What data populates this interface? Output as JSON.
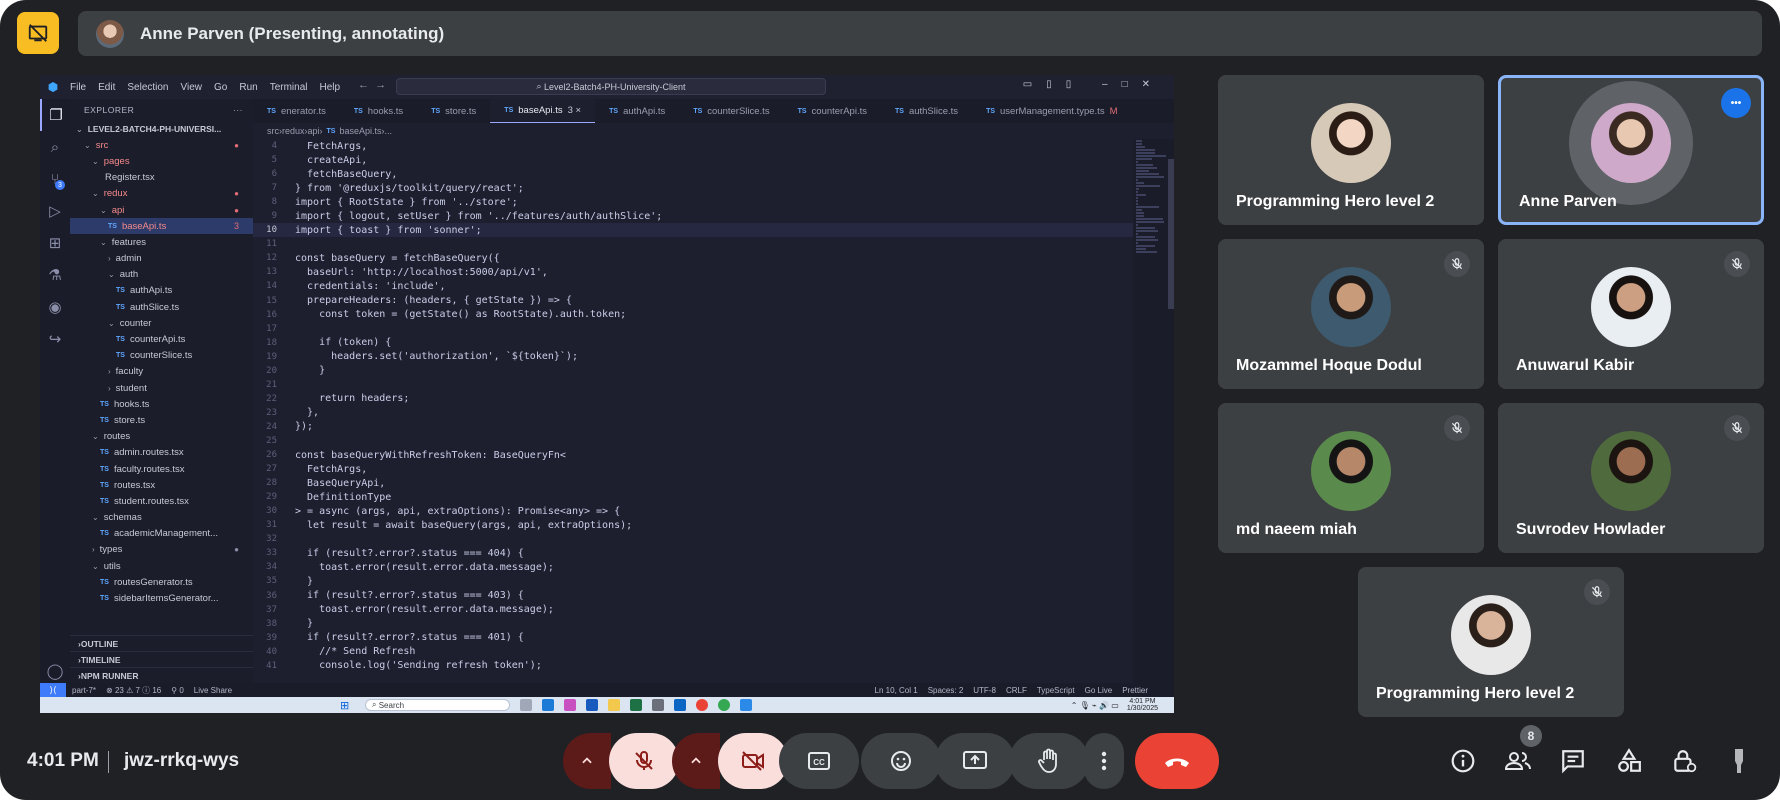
{
  "presenting": {
    "label": "Anne Parven (Presenting, annotating)"
  },
  "vscode": {
    "menu": [
      "File",
      "Edit",
      "Selection",
      "View",
      "Go",
      "Run",
      "Terminal",
      "Help"
    ],
    "search": "Level2-Batch4-PH-University-Client",
    "explorer_title": "EXPLORER",
    "project": "LEVEL2-BATCH4-PH-UNIVERSI...",
    "tree": [
      {
        "label": "src",
        "kind": "folder",
        "indent": 1,
        "status": "dot",
        "red": true
      },
      {
        "label": "pages",
        "kind": "folder",
        "indent": 2,
        "status": "",
        "red": true
      },
      {
        "label": "Register.tsx",
        "kind": "plain",
        "indent": 3,
        "status": ""
      },
      {
        "label": "redux",
        "kind": "folder",
        "indent": 2,
        "status": "dot",
        "red": true
      },
      {
        "label": "api",
        "kind": "folder",
        "indent": 3,
        "status": "dot",
        "red": true
      },
      {
        "label": "baseApi.ts",
        "kind": "ts",
        "indent": 4,
        "status": "3",
        "sel": true,
        "red": true
      },
      {
        "label": "features",
        "kind": "folder",
        "indent": 3,
        "status": ""
      },
      {
        "label": "admin",
        "kind": "folder-closed",
        "indent": 4,
        "status": ""
      },
      {
        "label": "auth",
        "kind": "folder",
        "indent": 4,
        "status": ""
      },
      {
        "label": "authApi.ts",
        "kind": "ts",
        "indent": 5,
        "status": ""
      },
      {
        "label": "authSlice.ts",
        "kind": "ts",
        "indent": 5,
        "status": ""
      },
      {
        "label": "counter",
        "kind": "folder",
        "indent": 4,
        "status": ""
      },
      {
        "label": "counterApi.ts",
        "kind": "ts",
        "indent": 5,
        "status": ""
      },
      {
        "label": "counterSlice.ts",
        "kind": "ts",
        "indent": 5,
        "status": ""
      },
      {
        "label": "faculty",
        "kind": "folder-closed",
        "indent": 4,
        "status": ""
      },
      {
        "label": "student",
        "kind": "folder-closed",
        "indent": 4,
        "status": ""
      },
      {
        "label": "hooks.ts",
        "kind": "ts",
        "indent": 3,
        "status": ""
      },
      {
        "label": "store.ts",
        "kind": "ts",
        "indent": 3,
        "status": ""
      },
      {
        "label": "routes",
        "kind": "folder",
        "indent": 2,
        "status": ""
      },
      {
        "label": "admin.routes.tsx",
        "kind": "tsx",
        "indent": 3,
        "status": ""
      },
      {
        "label": "faculty.routes.tsx",
        "kind": "tsx",
        "indent": 3,
        "status": ""
      },
      {
        "label": "routes.tsx",
        "kind": "tsx",
        "indent": 3,
        "status": ""
      },
      {
        "label": "student.routes.tsx",
        "kind": "tsx",
        "indent": 3,
        "status": ""
      },
      {
        "label": "schemas",
        "kind": "folder",
        "indent": 2,
        "status": ""
      },
      {
        "label": "academicManagement...",
        "kind": "ts",
        "indent": 3,
        "status": ""
      },
      {
        "label": "types",
        "kind": "folder-closed",
        "indent": 2,
        "status": "dot-grey"
      },
      {
        "label": "utils",
        "kind": "folder",
        "indent": 2,
        "status": ""
      },
      {
        "label": "routesGenerator.ts",
        "kind": "ts",
        "indent": 3,
        "status": ""
      },
      {
        "label": "sidebarItemsGenerator...",
        "kind": "ts",
        "indent": 3,
        "status": ""
      }
    ],
    "sections": [
      "OUTLINE",
      "TIMELINE",
      "NPM RUNNER"
    ],
    "tabs": [
      {
        "label": "enerator.ts",
        "active": false,
        "mod": ""
      },
      {
        "label": "hooks.ts",
        "active": false,
        "mod": ""
      },
      {
        "label": "store.ts",
        "active": false,
        "mod": ""
      },
      {
        "label": "baseApi.ts",
        "active": true,
        "mod": "3 ×"
      },
      {
        "label": "authApi.ts",
        "active": false,
        "mod": ""
      },
      {
        "label": "counterSlice.ts",
        "active": false,
        "mod": ""
      },
      {
        "label": "counterApi.ts",
        "active": false,
        "mod": ""
      },
      {
        "label": "authSlice.ts",
        "active": false,
        "mod": ""
      },
      {
        "label": "userManagement.type.ts",
        "active": false,
        "mod": "M"
      }
    ],
    "breadcrumb": [
      "src",
      "redux",
      "api",
      "baseApi.ts",
      "..."
    ],
    "current_line": 10,
    "code": [
      {
        "n": 4,
        "t": "  FetchArgs,"
      },
      {
        "n": 5,
        "t": "  createApi,"
      },
      {
        "n": 6,
        "t": "  fetchBaseQuery,"
      },
      {
        "n": 7,
        "t": "} from '@reduxjs/toolkit/query/react';"
      },
      {
        "n": 8,
        "t": "import { RootState } from '../store';"
      },
      {
        "n": 9,
        "t": "import { logout, setUser } from '../features/auth/authSlice';"
      },
      {
        "n": 10,
        "t": "import { toast } from 'sonner';"
      },
      {
        "n": 11,
        "t": ""
      },
      {
        "n": 12,
        "t": "const baseQuery = fetchBaseQuery({"
      },
      {
        "n": 13,
        "t": "  baseUrl: 'http://localhost:5000/api/v1',"
      },
      {
        "n": 14,
        "t": "  credentials: 'include',"
      },
      {
        "n": 15,
        "t": "  prepareHeaders: (headers, { getState }) => {"
      },
      {
        "n": 16,
        "t": "    const token = (getState() as RootState).auth.token;"
      },
      {
        "n": 17,
        "t": ""
      },
      {
        "n": 18,
        "t": "    if (token) {"
      },
      {
        "n": 19,
        "t": "      headers.set('authorization', `${token}`);"
      },
      {
        "n": 20,
        "t": "    }"
      },
      {
        "n": 21,
        "t": ""
      },
      {
        "n": 22,
        "t": "    return headers;"
      },
      {
        "n": 23,
        "t": "  },"
      },
      {
        "n": 24,
        "t": "});"
      },
      {
        "n": 25,
        "t": ""
      },
      {
        "n": 26,
        "t": "const baseQueryWithRefreshToken: BaseQueryFn<"
      },
      {
        "n": 27,
        "t": "  FetchArgs,"
      },
      {
        "n": 28,
        "t": "  BaseQueryApi,"
      },
      {
        "n": 29,
        "t": "  DefinitionType"
      },
      {
        "n": 30,
        "t": "> = async (args, api, extraOptions): Promise<any> => {"
      },
      {
        "n": 31,
        "t": "  let result = await baseQuery(args, api, extraOptions);"
      },
      {
        "n": 32,
        "t": ""
      },
      {
        "n": 33,
        "t": "  if (result?.error?.status === 404) {"
      },
      {
        "n": 34,
        "t": "    toast.error(result.error.data.message);"
      },
      {
        "n": 35,
        "t": "  }"
      },
      {
        "n": 36,
        "t": "  if (result?.error?.status === 403) {"
      },
      {
        "n": 37,
        "t": "    toast.error(result.error.data.message);"
      },
      {
        "n": 38,
        "t": "  }"
      },
      {
        "n": 39,
        "t": "  if (result?.error?.status === 401) {"
      },
      {
        "n": 40,
        "t": "    //* Send Refresh"
      },
      {
        "n": 41,
        "t": "    console.log('Sending refresh token');"
      }
    ],
    "status_left": [
      "part-7*",
      "⊗ 23 ⚠ 7 ⓘ 16",
      "⚲ 0",
      "Live Share"
    ],
    "status_right": [
      "Ln 10, Col 1",
      "Spaces: 2",
      "UTF-8",
      "CRLF",
      "TypeScript",
      "Go Live",
      "Prettier"
    ],
    "taskbar_search": "Search",
    "clock_time": "4:01 PM",
    "clock_date": "1/30/2025"
  },
  "participants": [
    {
      "name": "Programming Hero level 2",
      "muted": false,
      "active": false
    },
    {
      "name": "Anne Parven",
      "muted": false,
      "active": true
    },
    {
      "name": "Mozammel Hoque Dodul",
      "muted": true,
      "active": false
    },
    {
      "name": "Anuwarul Kabir",
      "muted": true,
      "active": false
    },
    {
      "name": "md naeem miah",
      "muted": true,
      "active": false
    },
    {
      "name": "Suvrodev Howlader",
      "muted": true,
      "active": false
    },
    {
      "name": "Programming Hero level 2",
      "muted": true,
      "active": false
    }
  ],
  "bottom": {
    "time": "4:01 PM",
    "meeting_code": "jwz-rrkq-wys",
    "people_count": "8"
  },
  "colors": {
    "background": "#202124",
    "tile": "#3c4043",
    "hangup": "#ea4335",
    "active_border": "#8ab4f8",
    "present_icon": "#f8bd22"
  }
}
